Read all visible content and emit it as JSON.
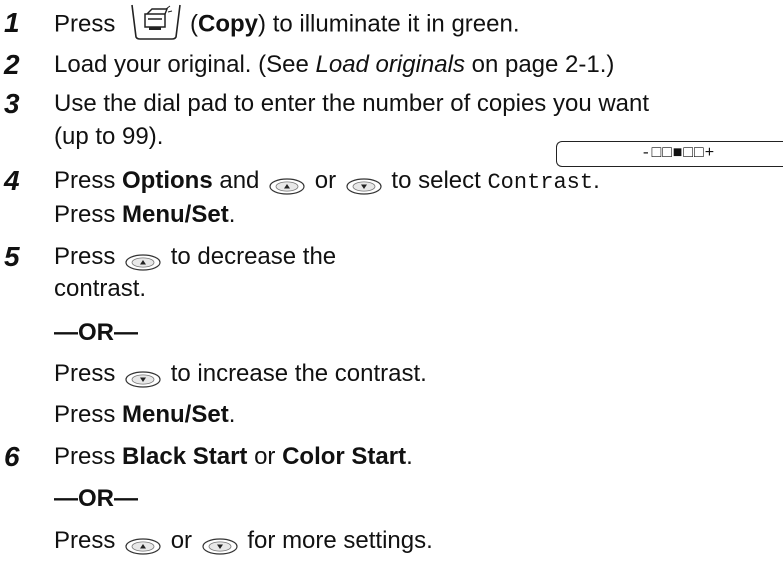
{
  "steps": [
    {
      "num": "1",
      "line1": {
        "a": "Press",
        "b": "(",
        "c": "Copy",
        "d": ") to illuminate it in green."
      }
    },
    {
      "num": "2",
      "line1": {
        "a": "Load your original. (See ",
        "b": "Load originals",
        "c": " on page 2-1.)"
      }
    },
    {
      "num": "3",
      "line1": "Use the dial pad to enter the number of copies you want",
      "line2": "(up to 99)."
    },
    {
      "num": "4",
      "line1": {
        "a": "Press ",
        "b": "Options",
        "c": " and",
        "d": "or",
        "e": "to select ",
        "f": "Contrast",
        "g": "."
      },
      "line2": {
        "a": "Press ",
        "b": "Menu/Set",
        "c": "."
      }
    },
    {
      "num": "5",
      "line1": {
        "a": "Press",
        "b": "to decrease the"
      },
      "line2": "contrast.",
      "or1": "—OR—",
      "line3": {
        "a": "Press",
        "b": "to increase the contrast."
      },
      "line4": {
        "a": "Press ",
        "b": "Menu/Set",
        "c": "."
      }
    },
    {
      "num": "6",
      "line1": {
        "a": "Press ",
        "b": "Black Start",
        "c": " or ",
        "d": "Color Start",
        "e": "."
      },
      "or1": "—OR—",
      "line2": {
        "a": "Press",
        "b": "or",
        "c": "for more settings."
      }
    }
  ],
  "lcd": {
    "text": "-□□■□□+"
  },
  "icons": {
    "copy": "copy-key-icon",
    "up": "up-arrow-key-icon",
    "down": "down-arrow-key-icon"
  }
}
